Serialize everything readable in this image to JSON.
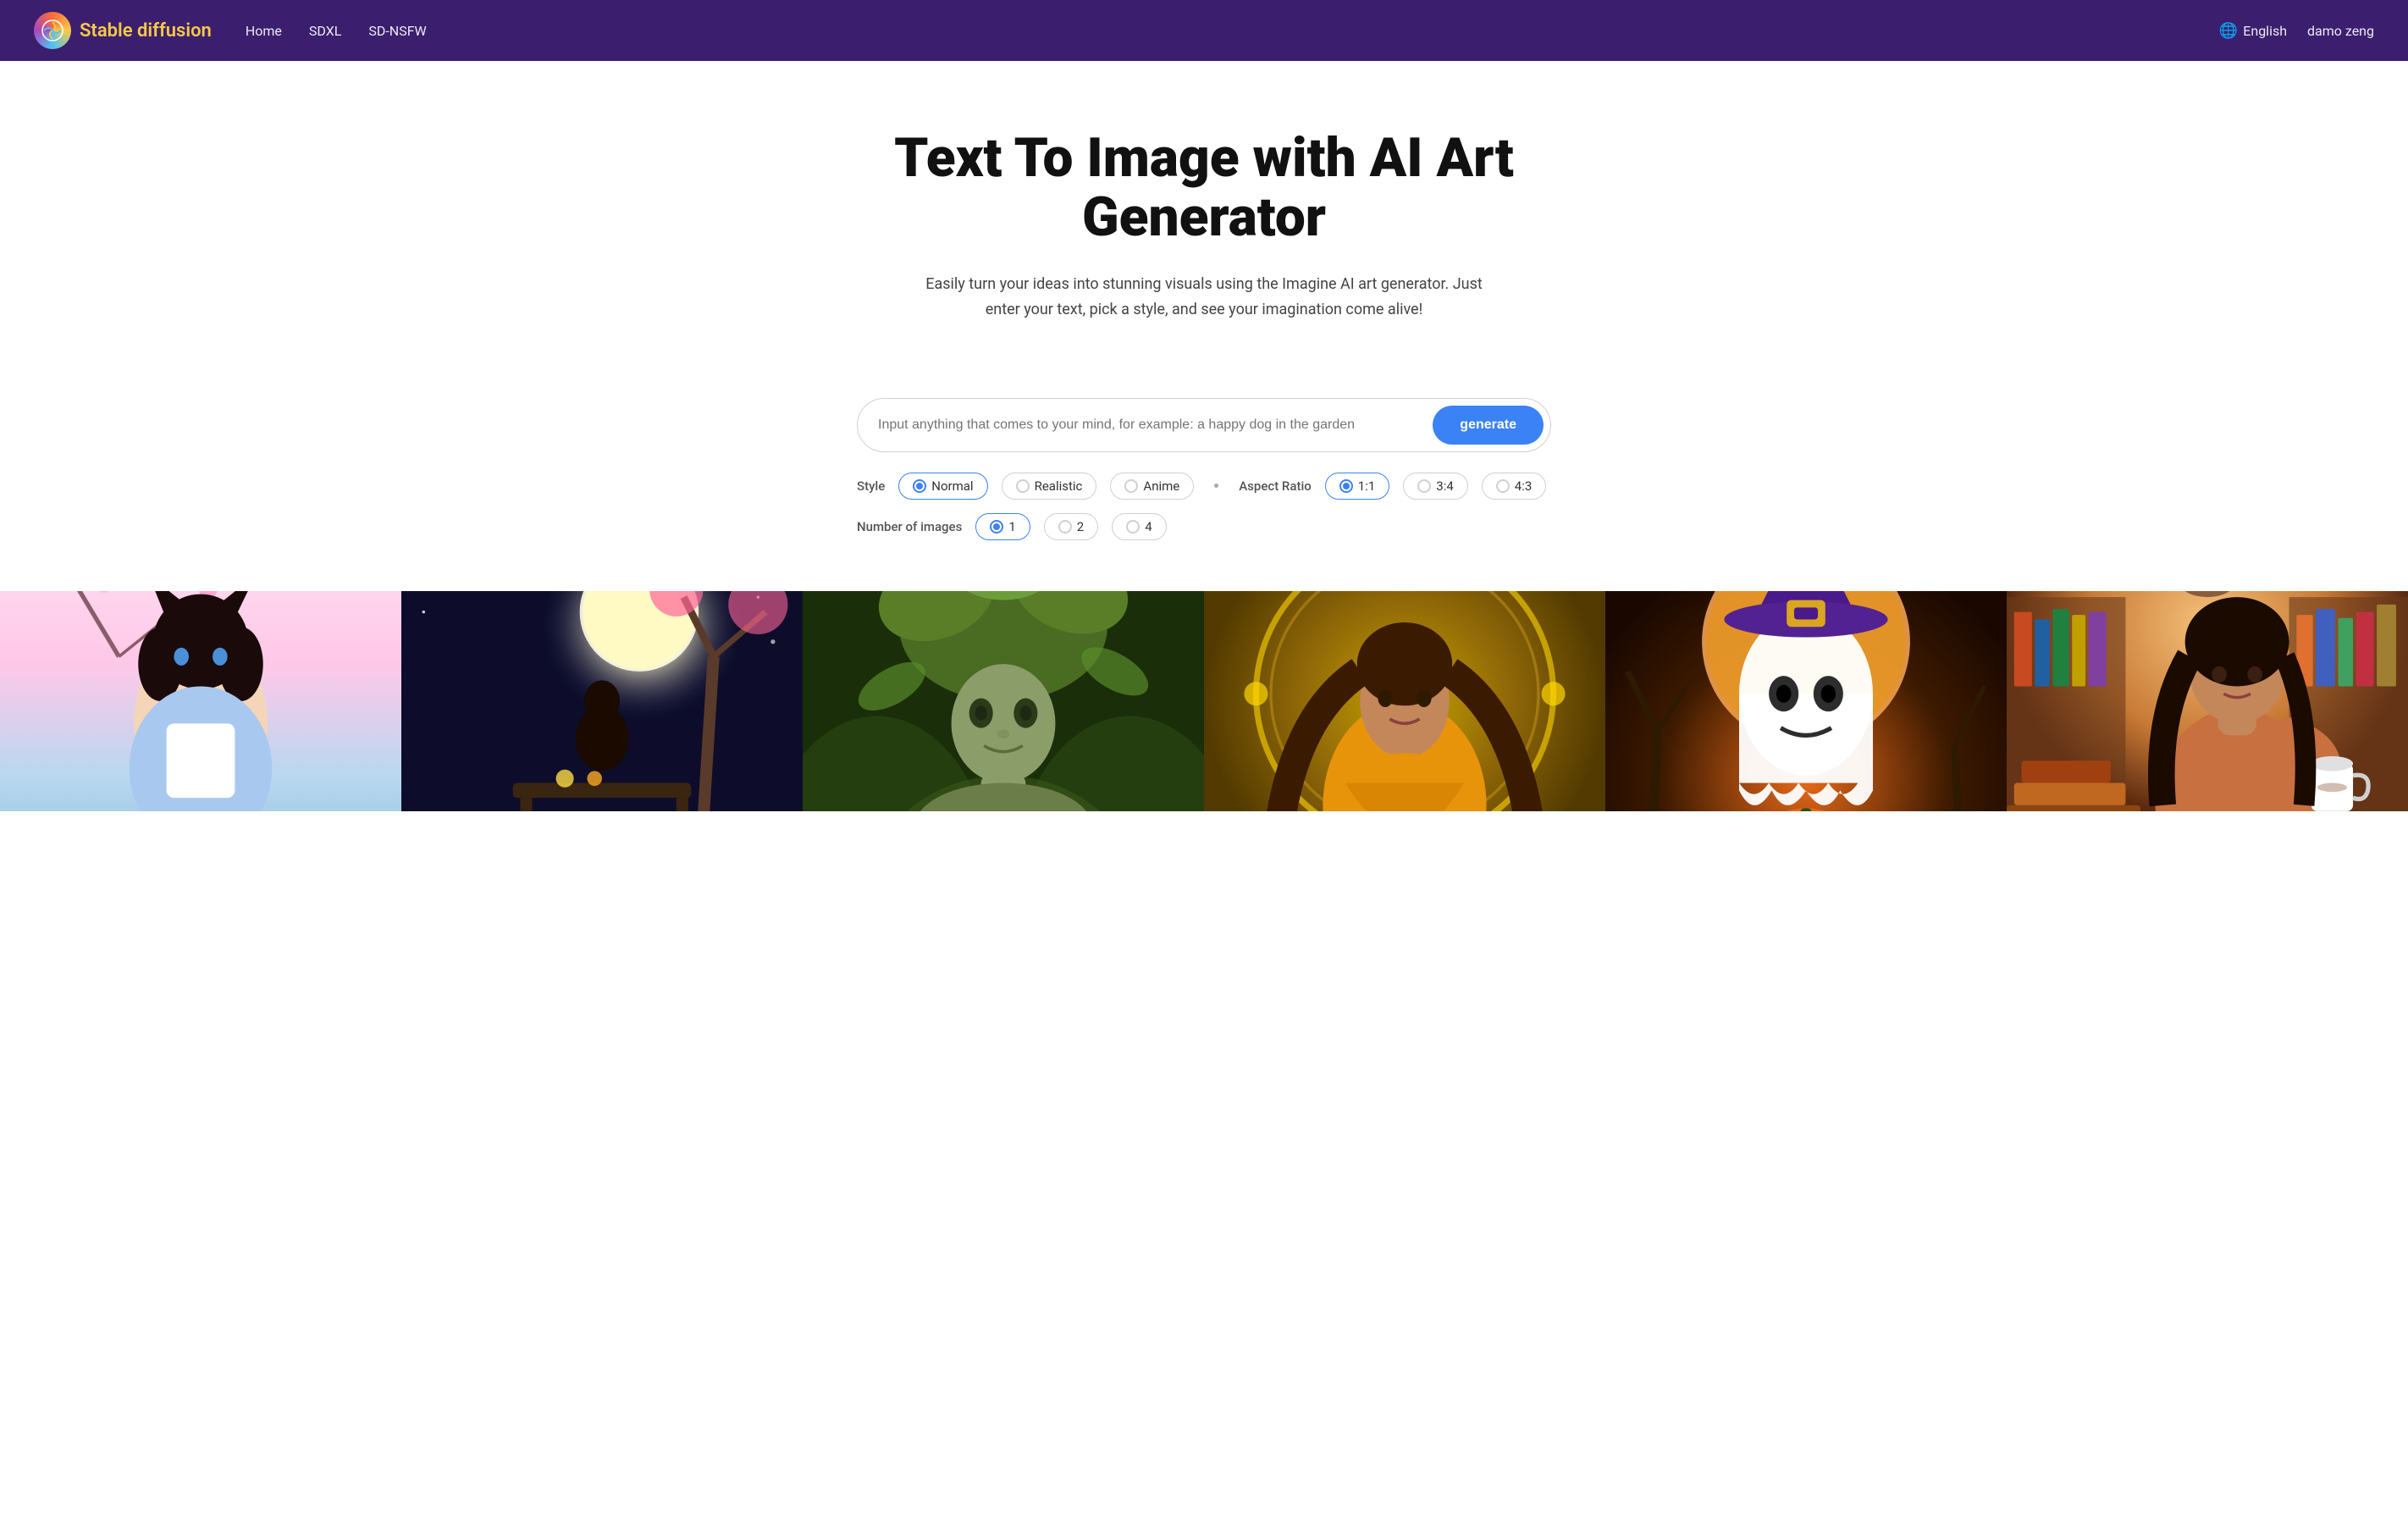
{
  "navbar": {
    "logo_text_stable": "Stable ",
    "logo_text_diffusion": "diffusion",
    "nav_home": "Home",
    "nav_sdxl": "SDXL",
    "nav_nsfw": "SD-NSFW",
    "language": "English",
    "user_name": "damo zeng"
  },
  "hero": {
    "title": "Text To Image with AI Art Generator",
    "subtitle": "Easily turn your ideas into stunning visuals using the Imagine AI art generator. Just enter your text, pick a style, and see your imagination come alive!",
    "input_placeholder": "Input anything that comes to your mind, for example: a happy dog in the garden",
    "generate_button": "generate"
  },
  "style_options": {
    "label": "Style",
    "options": [
      {
        "value": "normal",
        "label": "Normal",
        "active": true
      },
      {
        "value": "realistic",
        "label": "Realistic",
        "active": false
      },
      {
        "value": "anime",
        "label": "Anime",
        "active": false
      }
    ]
  },
  "aspect_ratio": {
    "label": "Aspect Ratio",
    "options": [
      {
        "value": "1:1",
        "label": "1:1",
        "active": true
      },
      {
        "value": "3:4",
        "label": "3:4",
        "active": false
      },
      {
        "value": "4:3",
        "label": "4:3",
        "active": false
      }
    ]
  },
  "num_images": {
    "label": "Number of images",
    "options": [
      {
        "value": "1",
        "label": "1",
        "active": true
      },
      {
        "value": "2",
        "label": "2",
        "active": false
      },
      {
        "value": "4",
        "label": "4",
        "active": false
      }
    ]
  },
  "gallery": {
    "images": [
      {
        "id": 1,
        "alt": "anime girl with cat ears and cherry blossoms"
      },
      {
        "id": 2,
        "alt": "person sitting at table under full moon with cherry blossoms"
      },
      {
        "id": 3,
        "alt": "forest goddess with leaf crown"
      },
      {
        "id": 4,
        "alt": "woman in golden circle with long hair"
      },
      {
        "id": 5,
        "alt": "halloween ghost with pumpkin and witch hat"
      },
      {
        "id": 6,
        "alt": "woman reading with coffee and books"
      }
    ]
  },
  "colors": {
    "navbar_bg": "#3b1f6e",
    "generate_btn": "#3b82f6",
    "accent_yellow": "#f7c948"
  }
}
